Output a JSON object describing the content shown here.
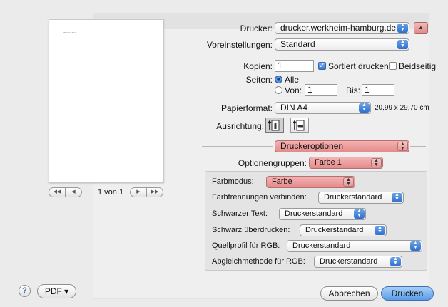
{
  "preview": {
    "page_text": "Website Titel",
    "page_count": "1 von 1"
  },
  "printer": {
    "label": "Drucker:",
    "value": "drucker.werkheim-hamburg.de"
  },
  "presets": {
    "label": "Voreinstellungen:",
    "value": "Standard"
  },
  "copies": {
    "label": "Kopien:",
    "value": "1",
    "collate_label": "Sortiert drucken",
    "collate_checked": true,
    "duplex_label": "Beidseitig",
    "duplex_checked": false
  },
  "pages": {
    "label": "Seiten:",
    "all_label": "Alle",
    "from_label": "Von:",
    "from_value": "1",
    "to_label": "Bis:",
    "to_value": "1",
    "selected": "all"
  },
  "paper": {
    "label": "Papierformat:",
    "value": "DIN A4",
    "size": "20,99 x 29,70 cm"
  },
  "orientation": {
    "label": "Ausrichtung:",
    "selected": "portrait"
  },
  "section": {
    "value": "Druckeroptionen"
  },
  "option_groups": {
    "label": "Optionengruppen:",
    "value": "Farbe 1"
  },
  "options": [
    {
      "label": "Farbmodus:",
      "value": "Farbe"
    },
    {
      "label": "Farbtrennungen verbinden:",
      "value": "Druckerstandard"
    },
    {
      "label": "Schwarzer Text:",
      "value": "Druckerstandard"
    },
    {
      "label": "Schwarz überdrucken:",
      "value": "Druckerstandard"
    },
    {
      "label": "Quellprofil für RGB:",
      "value": "Druckerstandard"
    },
    {
      "label": "Abgleichmethode für RGB:",
      "value": "Druckerstandard"
    }
  ],
  "footer": {
    "help": "?",
    "pdf": "PDF ▾",
    "cancel": "Abbrechen",
    "print": "Drucken"
  },
  "colors": {
    "highlight": "#e48b8b",
    "accent": "#3476d6"
  }
}
